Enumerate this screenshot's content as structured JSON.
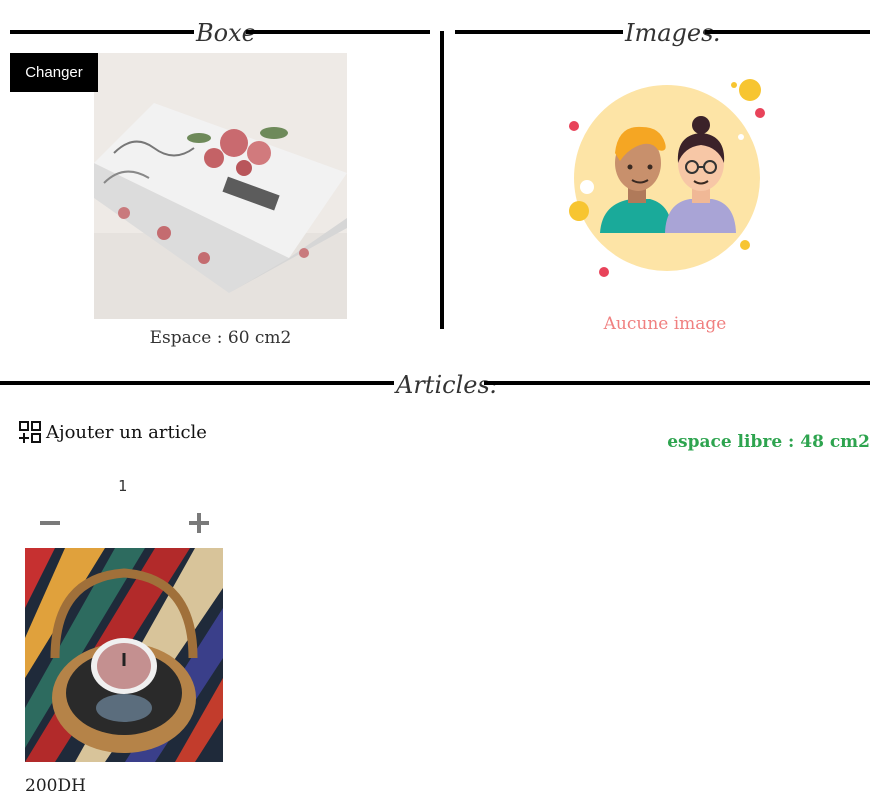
{
  "boxe_section": {
    "title": "Boxe",
    "change_label": "Changer",
    "space_label": "Espace : 60 cm2"
  },
  "images_section": {
    "title": "Images:",
    "empty_label": "Aucune image"
  },
  "articles_section": {
    "title": "Articles:",
    "add_label": "Ajouter un article",
    "free_space_label": "espace libre : 48 cm2",
    "items": [
      {
        "quantity": "1",
        "price": "200DH"
      }
    ]
  },
  "colors": {
    "free_space": "#2ea44f",
    "empty_images": "#f08080",
    "divider": "#000000"
  },
  "icons": [
    "add-grid-icon",
    "minus-icon",
    "plus-icon"
  ]
}
